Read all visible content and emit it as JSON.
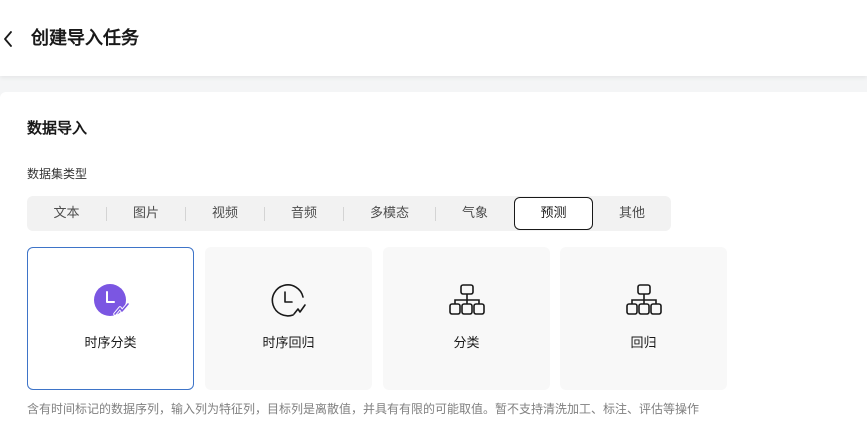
{
  "header": {
    "title": "创建导入任务"
  },
  "section": {
    "title": "数据导入",
    "dataset_type_label": "数据集类型"
  },
  "tabs": [
    {
      "label": "文本",
      "active": false
    },
    {
      "label": "图片",
      "active": false
    },
    {
      "label": "视频",
      "active": false
    },
    {
      "label": "音频",
      "active": false
    },
    {
      "label": "多模态",
      "active": false
    },
    {
      "label": "气象",
      "active": false
    },
    {
      "label": "预测",
      "active": true
    },
    {
      "label": "其他",
      "active": false
    }
  ],
  "cards": [
    {
      "label": "时序分类",
      "icon": "clock-trend-icon",
      "selected": true
    },
    {
      "label": "时序回归",
      "icon": "clock-trend-outline-icon",
      "selected": false
    },
    {
      "label": "分类",
      "icon": "hierarchy-icon",
      "selected": false
    },
    {
      "label": "回归",
      "icon": "hierarchy-icon",
      "selected": false
    }
  ],
  "description": "含有时间标记的数据序列，输入列为特征列，目标列是离散值，并具有有限的可能取值。暂不支持清洗加工、标注、评估等操作",
  "colors": {
    "accent_purple": "#7b56e2",
    "selected_border": "#3e74c8",
    "active_tab_border": "#191919"
  }
}
